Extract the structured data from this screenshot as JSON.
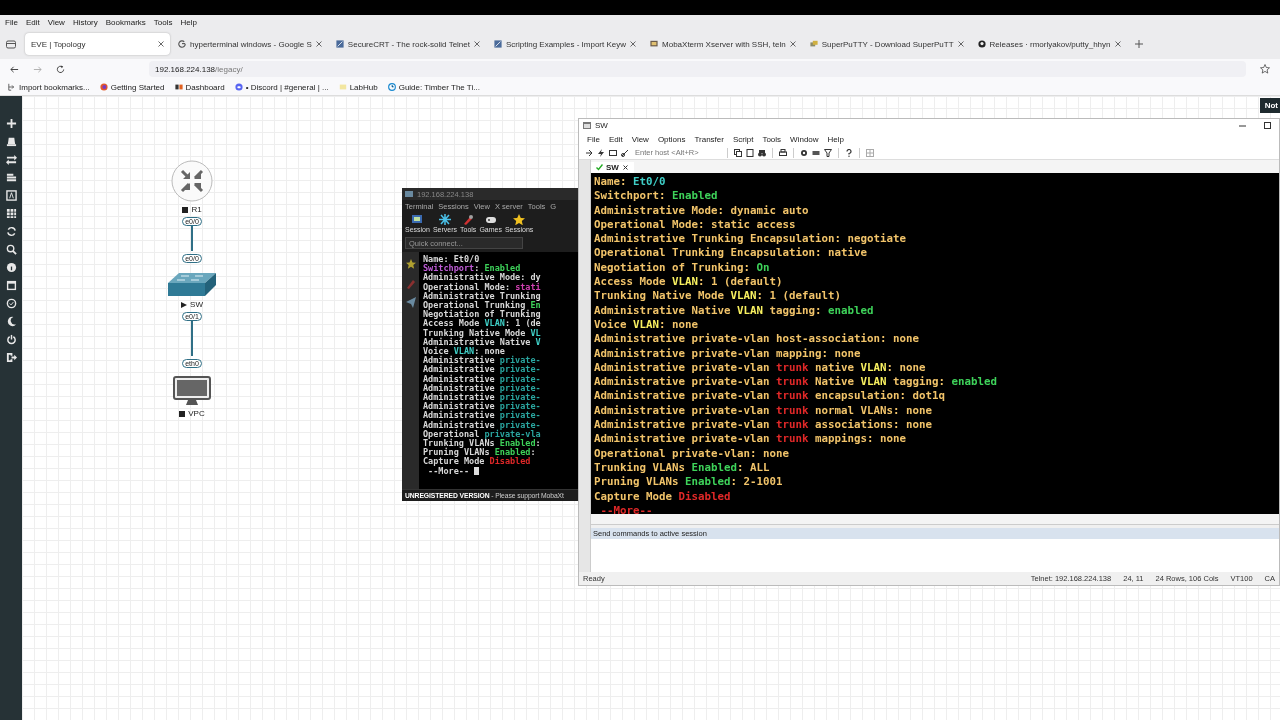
{
  "browser": {
    "menu": [
      "File",
      "Edit",
      "View",
      "History",
      "Bookmarks",
      "Tools",
      "Help"
    ],
    "tabs": [
      {
        "label": "EVE | Topology",
        "selected": true
      },
      {
        "label": "hyperterminal windows - Google S",
        "selected": false
      },
      {
        "label": "SecureCRT - The rock-solid Telnet",
        "selected": false
      },
      {
        "label": "Scripting Examples - Import Keyw",
        "selected": false
      },
      {
        "label": "MobaXterm Xserver with SSH, teln",
        "selected": false
      },
      {
        "label": "SuperPuTTY - Download SuperPuTT",
        "selected": false
      },
      {
        "label": "Releases · rmorlyakov/putty_hhyn",
        "selected": false
      }
    ],
    "url": {
      "host": "192.168.224.138",
      "path": "/legacy/"
    },
    "bookmarks": [
      "Import bookmarks...",
      "Getting Started",
      "Dashboard",
      "• Discord | #general | ...",
      "LabHub",
      "Guide: Timber The Ti..."
    ]
  },
  "badge": "Not",
  "topology": {
    "nodes": [
      {
        "label": "R1",
        "running": false,
        "kind": "router"
      },
      {
        "label": "SW",
        "running": true,
        "kind": "switch"
      },
      {
        "label": "VPC",
        "running": false,
        "kind": "pc"
      }
    ],
    "links": [
      {
        "ports": [
          "e0/0",
          "e0/0"
        ]
      },
      {
        "ports": [
          "e0/1",
          "eth0"
        ]
      }
    ]
  },
  "mobaxterm": {
    "title": "192.168.224.138",
    "menu": [
      "Terminal",
      "Sessions",
      "View",
      "X server",
      "Tools",
      "G"
    ],
    "toolbar": [
      "Session",
      "Servers",
      "Tools",
      "Games",
      "Sessions"
    ],
    "quick_connect": {
      "placeholder": "Quick connect..."
    },
    "lines": [
      [
        {
          "text": "Name: Et0/0",
          "color": "#d8d8d8"
        }
      ],
      [
        {
          "text": "Switchport",
          "color": "#c05cd8"
        },
        {
          "text": ": "
        },
        {
          "text": "Enabled",
          "color": "#3ed35a"
        }
      ],
      [
        {
          "text": "Administrative Mode: dy",
          "color": "#d8d8d8"
        }
      ],
      [
        {
          "text": "Operational Mode: ",
          "color": "#d8d8d8"
        },
        {
          "text": "stati",
          "color": "#d040b0"
        }
      ],
      [
        {
          "text": "Administrative Trunking",
          "color": "#d8d8d8"
        }
      ],
      [
        {
          "text": "Operational Trunking ",
          "color": "#d8d8d8"
        },
        {
          "text": "En",
          "color": "#3ed35a"
        }
      ],
      [
        {
          "text": "Negotiation of Trunking",
          "color": "#d8d8d8"
        }
      ],
      [
        {
          "text": "Access Mode ",
          "color": "#d8d8d8"
        },
        {
          "text": "VLAN",
          "color": "#3fd0c8"
        },
        {
          "text": ": 1 (de",
          "color": "#d8d8d8"
        }
      ],
      [
        {
          "text": "Trunking Native Mode ",
          "color": "#d8d8d8"
        },
        {
          "text": "VL",
          "color": "#3fd0c8"
        }
      ],
      [
        {
          "text": "Administrative Native ",
          "color": "#d8d8d8"
        },
        {
          "text": "V",
          "color": "#3fd0c8"
        }
      ],
      [
        {
          "text": "Voice ",
          "color": "#d8d8d8"
        },
        {
          "text": "VLAN",
          "color": "#3fd0c8"
        },
        {
          "text": ": none",
          "color": "#d8d8d8"
        }
      ],
      [
        {
          "text": "Administrative ",
          "color": "#d8d8d8"
        },
        {
          "text": "private-",
          "color": "#2aa6a0"
        }
      ],
      [
        {
          "text": "Administrative ",
          "color": "#d8d8d8"
        },
        {
          "text": "private-",
          "color": "#2aa6a0"
        }
      ],
      [
        {
          "text": "Administrative ",
          "color": "#d8d8d8"
        },
        {
          "text": "private-",
          "color": "#2aa6a0"
        }
      ],
      [
        {
          "text": "Administrative ",
          "color": "#d8d8d8"
        },
        {
          "text": "private-",
          "color": "#2aa6a0"
        }
      ],
      [
        {
          "text": "Administrative ",
          "color": "#d8d8d8"
        },
        {
          "text": "private-",
          "color": "#2aa6a0"
        }
      ],
      [
        {
          "text": "Administrative ",
          "color": "#d8d8d8"
        },
        {
          "text": "private-",
          "color": "#2aa6a0"
        }
      ],
      [
        {
          "text": "Administrative ",
          "color": "#d8d8d8"
        },
        {
          "text": "private-",
          "color": "#2aa6a0"
        }
      ],
      [
        {
          "text": "Administrative ",
          "color": "#d8d8d8"
        },
        {
          "text": "private-",
          "color": "#2aa6a0"
        }
      ],
      [
        {
          "text": "Operational ",
          "color": "#d8d8d8"
        },
        {
          "text": "private-vla",
          "color": "#2aa6a0"
        }
      ],
      [
        {
          "text": "Trunking VLANs ",
          "color": "#d8d8d8"
        },
        {
          "text": "Enabled",
          "color": "#3ed35a"
        },
        {
          "text": ":"
        }
      ],
      [
        {
          "text": "Pruning VLANs ",
          "color": "#d8d8d8"
        },
        {
          "text": "Enabled",
          "color": "#3ed35a"
        },
        {
          "text": ":"
        }
      ],
      [
        {
          "text": "Capture Mode ",
          "color": "#d8d8d8"
        },
        {
          "text": "Disabled",
          "color": "#e02828"
        }
      ],
      [
        {
          "text": " --More-- ",
          "color": "#d8d8d8"
        }
      ]
    ],
    "footer": {
      "strong": "UNREGISTERED VERSION",
      "rest": "- Please support MobaXt"
    }
  },
  "securecrt": {
    "title": "SW",
    "menu": [
      "File",
      "Edit",
      "View",
      "Options",
      "Transfer",
      "Script",
      "Tools",
      "Window",
      "Help"
    ],
    "host_field": {
      "placeholder": "Enter host <Alt+R>"
    },
    "session_tab": {
      "label": "SW",
      "connected": true
    },
    "lines": [
      [
        {
          "text": "Name: ",
          "color": "#f2c46a"
        },
        {
          "text": "Et0/0",
          "color": "#3fd0c8"
        }
      ],
      [
        {
          "text": "Switchport: ",
          "color": "#f2c46a"
        },
        {
          "text": "Enabled",
          "color": "#3ed35a"
        }
      ],
      [
        {
          "text": "Administrative Mode: dynamic auto",
          "color": "#f2c46a"
        }
      ],
      [
        {
          "text": "Operational Mode: static access",
          "color": "#f2c46a"
        }
      ],
      [
        {
          "text": "Administrative Trunking Encapsulation: negotiate",
          "color": "#f2c46a"
        }
      ],
      [
        {
          "text": "Operational Trunking Encapsulation: native",
          "color": "#f2c46a"
        }
      ],
      [
        {
          "text": "Negotiation of Trunking: ",
          "color": "#f2c46a"
        },
        {
          "text": "On",
          "color": "#3ed35a"
        }
      ],
      [
        {
          "text": "Access Mode ",
          "color": "#f2c46a"
        },
        {
          "text": "VLAN",
          "color": "#f8f060"
        },
        {
          "text": ": 1 (default)",
          "color": "#f2c46a"
        }
      ],
      [
        {
          "text": "Trunking Native Mode ",
          "color": "#f2c46a"
        },
        {
          "text": "VLAN",
          "color": "#f8f060"
        },
        {
          "text": ": 1 (default)",
          "color": "#f2c46a"
        }
      ],
      [
        {
          "text": "Administrative Native ",
          "color": "#f2c46a"
        },
        {
          "text": "VLAN",
          "color": "#f8f060"
        },
        {
          "text": " tagging: ",
          "color": "#f2c46a"
        },
        {
          "text": "enabled",
          "color": "#3ed35a"
        }
      ],
      [
        {
          "text": "Voice ",
          "color": "#f2c46a"
        },
        {
          "text": "VLAN",
          "color": "#f8f060"
        },
        {
          "text": ": none",
          "color": "#f2c46a"
        }
      ],
      [
        {
          "text": "Administrative private-vlan host-association: none",
          "color": "#f2c46a"
        }
      ],
      [
        {
          "text": "Administrative private-vlan mapping: none",
          "color": "#f2c46a"
        }
      ],
      [
        {
          "text": "Administrative private-vlan ",
          "color": "#f2c46a"
        },
        {
          "text": "trunk",
          "color": "#e02828"
        },
        {
          "text": " native ",
          "color": "#f2c46a"
        },
        {
          "text": "VLAN",
          "color": "#f8f060"
        },
        {
          "text": ": none",
          "color": "#f2c46a"
        }
      ],
      [
        {
          "text": "Administrative private-vlan ",
          "color": "#f2c46a"
        },
        {
          "text": "trunk",
          "color": "#e02828"
        },
        {
          "text": " Native ",
          "color": "#f2c46a"
        },
        {
          "text": "VLAN",
          "color": "#f8f060"
        },
        {
          "text": " tagging: ",
          "color": "#f2c46a"
        },
        {
          "text": "enabled",
          "color": "#3ed35a"
        }
      ],
      [
        {
          "text": "Administrative private-vlan ",
          "color": "#f2c46a"
        },
        {
          "text": "trunk",
          "color": "#e02828"
        },
        {
          "text": " encapsulation: dot1q",
          "color": "#f2c46a"
        }
      ],
      [
        {
          "text": "Administrative private-vlan ",
          "color": "#f2c46a"
        },
        {
          "text": "trunk",
          "color": "#e02828"
        },
        {
          "text": " normal VLANs: none",
          "color": "#f2c46a"
        }
      ],
      [
        {
          "text": "Administrative private-vlan ",
          "color": "#f2c46a"
        },
        {
          "text": "trunk",
          "color": "#e02828"
        },
        {
          "text": " associations: none",
          "color": "#f2c46a"
        }
      ],
      [
        {
          "text": "Administrative private-vlan ",
          "color": "#f2c46a"
        },
        {
          "text": "trunk",
          "color": "#e02828"
        },
        {
          "text": " mappings: none",
          "color": "#f2c46a"
        }
      ],
      [
        {
          "text": "Operational private-vlan: none",
          "color": "#f2c46a"
        }
      ],
      [
        {
          "text": "Trunking VLANs ",
          "color": "#f2c46a"
        },
        {
          "text": "Enabled",
          "color": "#3ed35a"
        },
        {
          "text": ": ALL",
          "color": "#f2c46a"
        }
      ],
      [
        {
          "text": "Pruning VLANs ",
          "color": "#f2c46a"
        },
        {
          "text": "Enabled",
          "color": "#3ed35a"
        },
        {
          "text": ": 2-1001",
          "color": "#f2c46a"
        }
      ],
      [
        {
          "text": "Capture Mode ",
          "color": "#f2c46a"
        },
        {
          "text": "Disabled",
          "color": "#e02828"
        }
      ],
      [
        {
          "text": " --More--",
          "color": "#e02828"
        }
      ]
    ],
    "command_bar": "Send commands to active session",
    "status_bar": [
      "Ready",
      "Telnet: 192.168.224.138",
      "24, 11",
      "24 Rows, 106 Cols",
      "VT100",
      "CA"
    ]
  }
}
